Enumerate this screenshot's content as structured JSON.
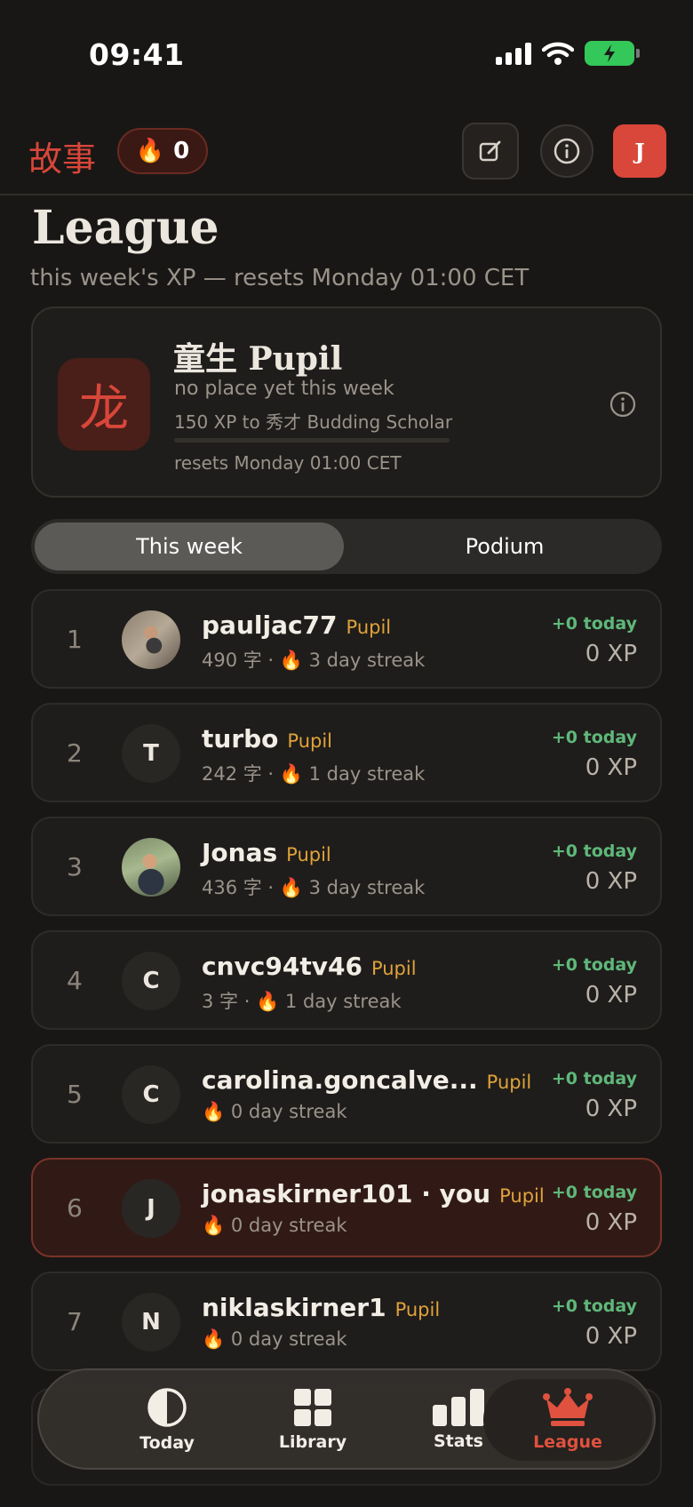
{
  "status": {
    "time": "09:41"
  },
  "header": {
    "logo": "故事",
    "streak_count": "0",
    "avatar_initial": "J"
  },
  "page": {
    "title": "League",
    "subtitle": "this week's XP — resets Monday 01:00 CET"
  },
  "rank_card": {
    "badge_char": "龙",
    "name": "童生 Pupil",
    "place_text": "no place yet this week",
    "next_text": "150 XP to 秀才 Budding Scholar",
    "progress": 0,
    "reset_text": "resets Monday 01:00 CET"
  },
  "segmented": {
    "tab1": "This week",
    "tab2": "Podium"
  },
  "leaderboard": [
    {
      "rank": "1",
      "avatar": "",
      "name": "pauljac77",
      "tier": "Pupil",
      "chars": "490 字 ·",
      "streak": "3 day streak",
      "today": "+0 today",
      "xp": "0 XP"
    },
    {
      "rank": "2",
      "avatar": "T",
      "name": "turbo",
      "tier": "Pupil",
      "chars": "242 字 ·",
      "streak": "1 day streak",
      "today": "+0 today",
      "xp": "0 XP"
    },
    {
      "rank": "3",
      "avatar": "",
      "name": "Jonas",
      "tier": "Pupil",
      "chars": "436 字 ·",
      "streak": "3 day streak",
      "today": "+0 today",
      "xp": "0 XP"
    },
    {
      "rank": "4",
      "avatar": "C",
      "name": "cnvc94tv46",
      "tier": "Pupil",
      "chars": "3 字 ·",
      "streak": "1 day streak",
      "today": "+0 today",
      "xp": "0 XP"
    },
    {
      "rank": "5",
      "avatar": "C",
      "name": "carolina.goncalve...",
      "tier": "Pupil",
      "chars": "",
      "streak": "0 day streak",
      "today": "+0 today",
      "xp": "0 XP"
    },
    {
      "rank": "6",
      "avatar": "J",
      "name": "jonaskirner101 · you",
      "tier": "Pupil",
      "chars": "",
      "streak": "0 day streak",
      "today": "+0 today",
      "xp": "0 XP"
    },
    {
      "rank": "7",
      "avatar": "N",
      "name": "niklaskirner1",
      "tier": "Pupil",
      "chars": "",
      "streak": "0 day streak",
      "today": "+0 today",
      "xp": "0 XP"
    }
  ],
  "tabs": [
    {
      "label": "Today",
      "icon": "half-circle-icon"
    },
    {
      "label": "Library",
      "icon": "grid-icon"
    },
    {
      "label": "Stats",
      "icon": "bar-chart-icon"
    },
    {
      "label": "League",
      "icon": "crown-icon"
    }
  ],
  "colors": {
    "accent": "#d9463a",
    "tier": "#e0a23b",
    "positive": "#5fb87a",
    "background": "#191715"
  }
}
